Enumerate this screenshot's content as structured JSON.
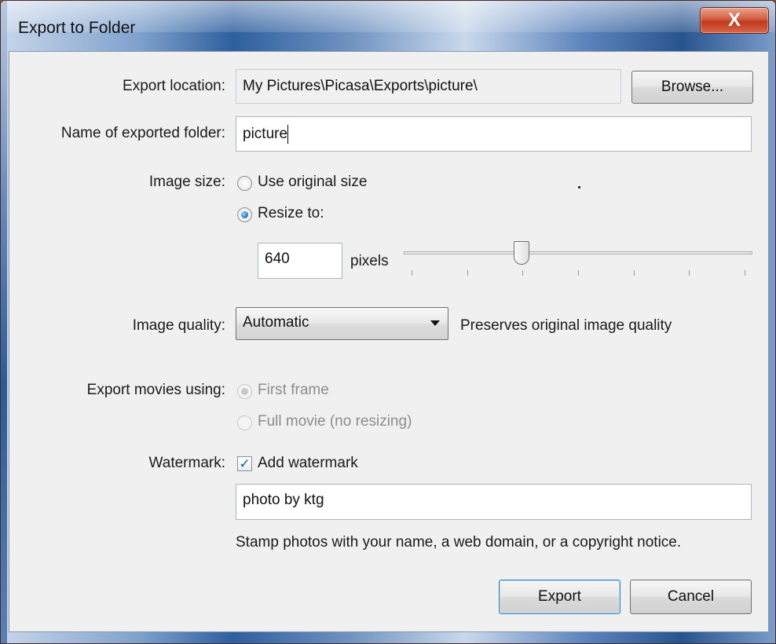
{
  "window": {
    "title": "Export to Folder",
    "close_glyph": "X"
  },
  "export_location": {
    "label": "Export location:",
    "value": "My Pictures\\Picasa\\Exports\\picture\\",
    "browse_label": "Browse..."
  },
  "folder_name": {
    "label": "Name of exported folder:",
    "value": "picture"
  },
  "image_size": {
    "label": "Image size:",
    "options": [
      {
        "label": "Use original size",
        "selected": false
      },
      {
        "label": "Resize to:",
        "selected": true
      }
    ],
    "pixels_value": "640",
    "pixels_unit": "pixels",
    "slider_level": 0.33
  },
  "image_quality": {
    "label": "Image quality:",
    "selected": "Automatic",
    "description": "Preserves original image quality"
  },
  "export_movies": {
    "label": "Export movies using:",
    "options": [
      {
        "label": "First frame",
        "selected": true,
        "disabled": true
      },
      {
        "label": "Full movie (no resizing)",
        "selected": false,
        "disabled": true
      }
    ]
  },
  "watermark": {
    "label": "Watermark:",
    "checkbox_label": "Add watermark",
    "checked": true,
    "text_value": "photo by ktg",
    "hint": "Stamp photos with your name, a web domain, or a copyright notice."
  },
  "footer": {
    "export_label": "Export",
    "cancel_label": "Cancel"
  },
  "colors": {
    "accent": "#2a7fc9",
    "close_button": "#c0391d",
    "client_background": "#f0f0f0"
  }
}
